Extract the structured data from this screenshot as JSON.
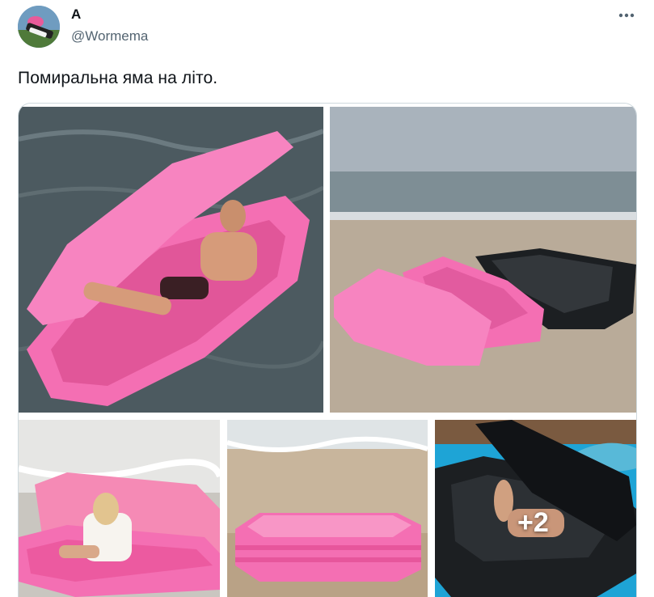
{
  "author": {
    "display_name": "A",
    "handle": "@Wormema",
    "avatar_icon": "user-avatar-photo"
  },
  "more_icon": "more-options-icon",
  "tweet": {
    "text": "Помиральна яма на літо."
  },
  "media": {
    "photo_count_total": 7,
    "photos": [
      {
        "name": "photo-man-in-pink-coffin-float",
        "subject": "pink coffin float on water"
      },
      {
        "name": "photo-pink-and-black-coffins-on-beach",
        "subject": "pink and black coffin floats on sand"
      },
      {
        "name": "photo-woman-in-pink-coffin",
        "subject": "pink coffin float at shoreline"
      },
      {
        "name": "photo-pink-coffin-on-sand",
        "subject": "pink coffin float on beach"
      },
      {
        "name": "photo-black-coffin-in-pool",
        "subject": "black coffin float in pool"
      }
    ],
    "overflow_label": "+2"
  },
  "colors": {
    "pink": "#f46fb3",
    "black_float": "#1c1f22",
    "pool": "#1ea4d6"
  }
}
